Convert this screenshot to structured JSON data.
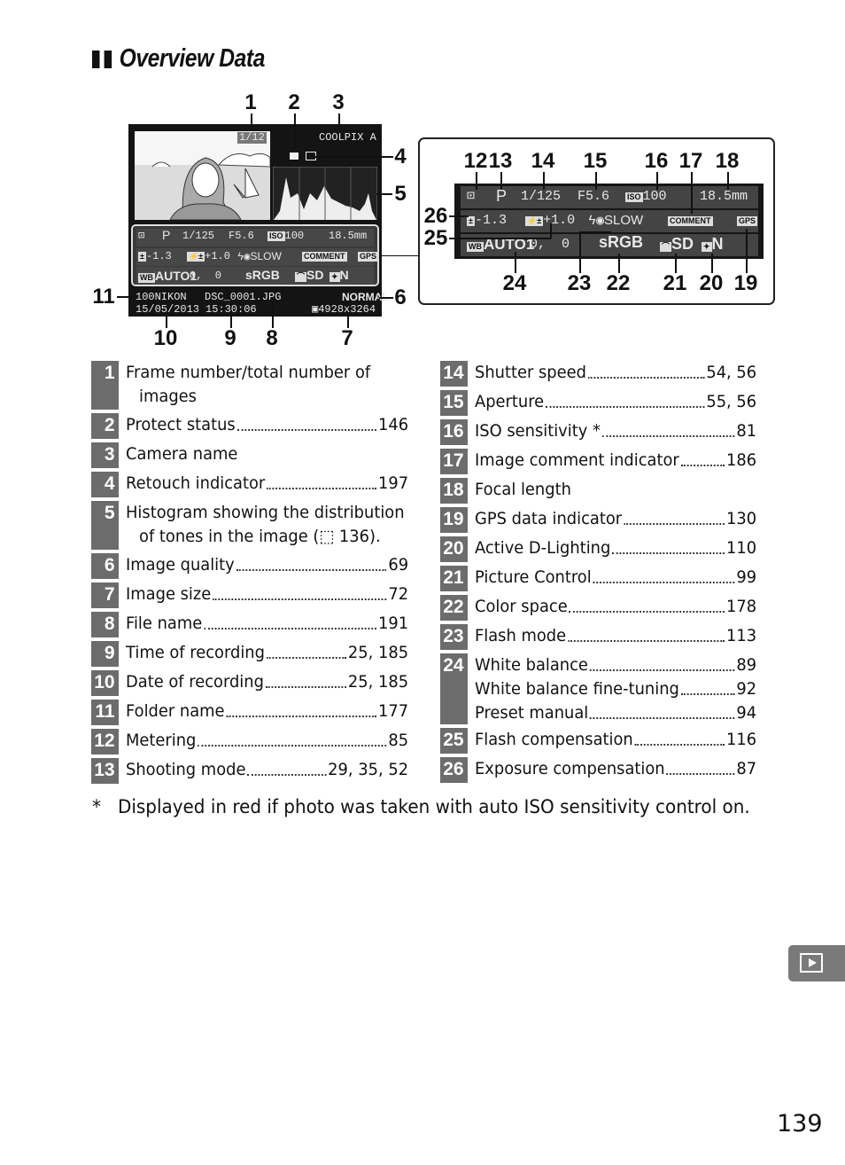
{
  "title": "Overview Data",
  "screen": {
    "frame": "1/12",
    "camera": "COOLPIX A",
    "row1": {
      "mode": "P",
      "shutter": "1/125",
      "aperture": "F5.6",
      "iso_icon": "ISO",
      "iso": "100",
      "focal": "18.5mm"
    },
    "row2": {
      "exp_comp": "-1.3",
      "flash_comp": "+1.0",
      "flash_mode": "SLOW",
      "comment": "COMMENT",
      "gps": "GPS"
    },
    "row3": {
      "wb_icon": "WB",
      "wb": "AUTO1",
      "wb_fine": "0,  0",
      "color_space": "sRGB",
      "picture_control": "SD",
      "adl": "N"
    },
    "folder": "100NIKON",
    "file": "DSC_0001.JPG",
    "quality": "NORMAL",
    "date": "15/05/2013",
    "time": "15:30:06",
    "size": "4928x3264"
  },
  "callouts": {
    "c1": "1",
    "c2": "2",
    "c3": "3",
    "c4": "4",
    "c5": "5",
    "c6": "6",
    "c7": "7",
    "c8": "8",
    "c9": "9",
    "c10": "10",
    "c11": "11",
    "c12": "12",
    "c13": "13",
    "c14": "14",
    "c15": "15",
    "c16": "16",
    "c17": "17",
    "c18": "18",
    "c19": "19",
    "c20": "20",
    "c21": "21",
    "c22": "22",
    "c23": "23",
    "c24": "24",
    "c25": "25",
    "c26": "26"
  },
  "left_items": [
    {
      "n": "1",
      "label": "Frame number/total number of",
      "label2": "images",
      "page": ""
    },
    {
      "n": "2",
      "label": "Protect status",
      "page": "146"
    },
    {
      "n": "3",
      "label": "Camera name",
      "page": ""
    },
    {
      "n": "4",
      "label": "Retouch indicator",
      "page": "197"
    },
    {
      "n": "5",
      "label": "Histogram showing the distribution",
      "label2": "of tones in the image (⬚ 136).",
      "page": ""
    },
    {
      "n": "6",
      "label": "Image quality",
      "page": "69"
    },
    {
      "n": "7",
      "label": "Image size",
      "page": "72"
    },
    {
      "n": "8",
      "label": "File name",
      "page": "191"
    },
    {
      "n": "9",
      "label": "Time of recording",
      "page": "25, 185"
    },
    {
      "n": "10",
      "label": "Date of recording",
      "page": "25, 185"
    },
    {
      "n": "11",
      "label": "Folder name",
      "page": "177"
    },
    {
      "n": "12",
      "label": "Metering",
      "page": "85"
    },
    {
      "n": "13",
      "label": "Shooting mode",
      "page": "29, 35, 52"
    }
  ],
  "right_items": [
    {
      "n": "14",
      "label": "Shutter speed",
      "page": "54, 56"
    },
    {
      "n": "15",
      "label": "Aperture",
      "page": "55, 56"
    },
    {
      "n": "16",
      "label": "ISO sensitivity *",
      "page": "81"
    },
    {
      "n": "17",
      "label": "Image comment indicator",
      "page": "186"
    },
    {
      "n": "18",
      "label": "Focal length",
      "page": ""
    },
    {
      "n": "19",
      "label": "GPS data indicator",
      "page": "130"
    },
    {
      "n": "20",
      "label": "Active D-Lighting",
      "page": "110"
    },
    {
      "n": "21",
      "label": "Picture Control",
      "page": "99"
    },
    {
      "n": "22",
      "label": "Color space",
      "page": "178"
    },
    {
      "n": "23",
      "label": "Flash mode",
      "page": "113"
    },
    {
      "n": "24",
      "label": "White balance",
      "page": "89",
      "sub": [
        {
          "label": "White balance fine-tuning",
          "page": "92"
        },
        {
          "label": "Preset manual",
          "page": "94"
        }
      ]
    },
    {
      "n": "25",
      "label": "Flash compensation",
      "page": "116"
    },
    {
      "n": "26",
      "label": "Exposure compensation",
      "page": "87"
    }
  ],
  "footnote": "*   Displayed in red if photo was taken with auto ISO sensitivity control on.",
  "side_tab_icon": "playback-icon",
  "page_number": "139"
}
